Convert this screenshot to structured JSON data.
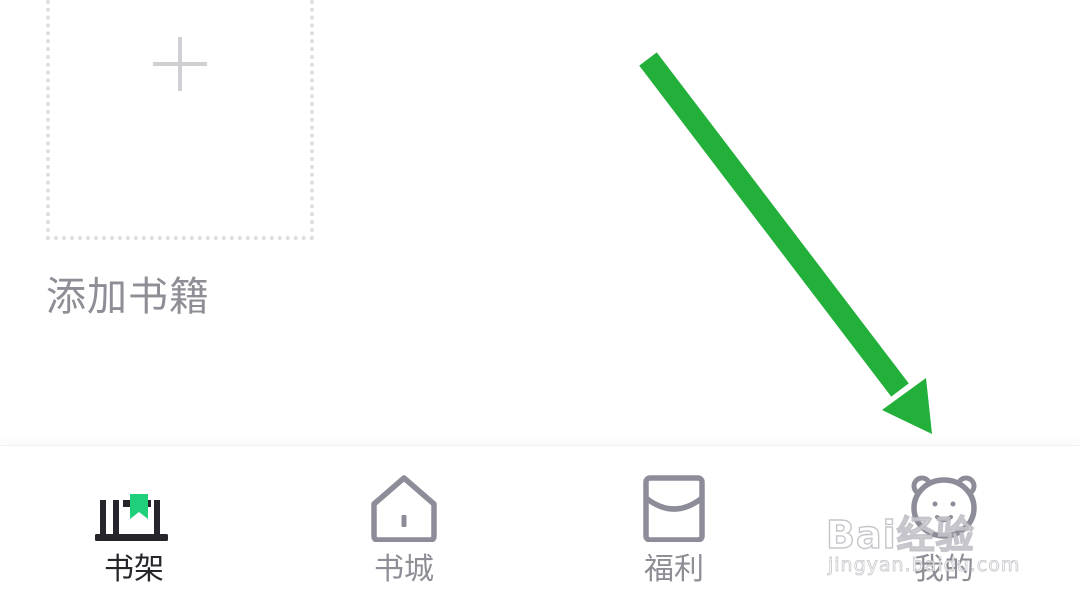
{
  "add_book": {
    "label": "添加书籍",
    "icon": "plus-icon"
  },
  "tabs": [
    {
      "label": "书架",
      "icon": "bookshelf-icon",
      "active": true
    },
    {
      "label": "书城",
      "icon": "home-icon",
      "active": false
    },
    {
      "label": "福利",
      "icon": "red-envelope-icon",
      "active": false
    },
    {
      "label": "我的",
      "icon": "bear-face-icon",
      "active": false
    }
  ],
  "watermark": {
    "brand": "Bai经验",
    "url": "jingyan.baidu.com"
  },
  "colors": {
    "accent_green": "#1fcf7a",
    "arrow_green": "#22b03a",
    "active_text": "#25252b",
    "inactive_text": "#8e8e96",
    "icon_gray": "#8d8d99"
  }
}
